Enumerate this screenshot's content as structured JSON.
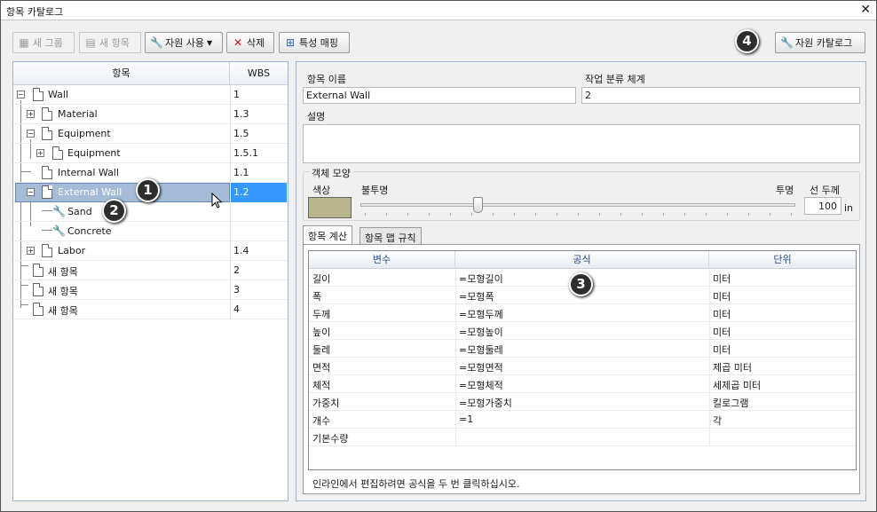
{
  "window": {
    "title": "항목 카탈로그",
    "close_glyph": "✕"
  },
  "toolbar": {
    "new_group": "새 그룹",
    "new_item": "새 항목",
    "use_resource": "자원 사용",
    "delete": "삭제",
    "property_mapping": "특성 매핑",
    "resource_catalog": "자원 카탈로그"
  },
  "tree": {
    "header_item": "항목",
    "header_wbs": "WBS",
    "rows": [
      {
        "label": "Wall",
        "wbs": "1"
      },
      {
        "label": "Material",
        "wbs": "1.3"
      },
      {
        "label": "Equipment",
        "wbs": "1.5"
      },
      {
        "label": "Equipment",
        "wbs": "1.5.1"
      },
      {
        "label": "Internal Wall",
        "wbs": "1.1"
      },
      {
        "label": "External Wall",
        "wbs": "1.2"
      },
      {
        "label": "Sand",
        "wbs": ""
      },
      {
        "label": "Concrete",
        "wbs": ""
      },
      {
        "label": "Labor",
        "wbs": "1.4"
      },
      {
        "label": "새 항목",
        "wbs": "2"
      },
      {
        "label": "새 항목",
        "wbs": "3"
      },
      {
        "label": "새 항목",
        "wbs": "4"
      }
    ]
  },
  "details": {
    "item_name_label": "항목 이름",
    "item_name_value": "External Wall",
    "wbs_label": "작업 분류 체계",
    "wbs_value": "2",
    "description_label": "설명",
    "description_value": "",
    "appearance_label": "객체 모양",
    "color_label": "색상",
    "opaque_label": "불투명",
    "transparent_label": "투명",
    "line_thickness_label": "선 두께",
    "line_thickness_value": "100",
    "line_thickness_unit": "in",
    "transparency_level": 0.27,
    "swatch_color": "#b8b58c"
  },
  "tabs": [
    {
      "label": "항목 계산",
      "active": true
    },
    {
      "label": "항목 맵 규칙",
      "active": false
    }
  ],
  "grid": {
    "headers": [
      "변수",
      "공식",
      "단위"
    ],
    "rows": [
      [
        "길이",
        "=모형길이",
        "미터"
      ],
      [
        "폭",
        "=모형폭",
        "미터"
      ],
      [
        "두께",
        "=모형두께",
        "미터"
      ],
      [
        "높이",
        "=모형높이",
        "미터"
      ],
      [
        "둘레",
        "=모형둘레",
        "미터"
      ],
      [
        "면적",
        "=모형면적",
        "제곱 미터"
      ],
      [
        "체적",
        "=모형체적",
        "세제곱 미터"
      ],
      [
        "가중치",
        "=모형가중치",
        "킬로그램"
      ],
      [
        "개수",
        "=1",
        "각"
      ],
      [
        "기본수량",
        "",
        ""
      ]
    ]
  },
  "status_hint": "인라인에서 편집하려면 공식을 두 번 클릭하십시오.",
  "callouts": [
    "1",
    "2",
    "3",
    "4"
  ],
  "icons": {
    "new_group": "new-group-icon",
    "new_item": "new-item-icon",
    "use_resource": "wrench-icon",
    "delete": "red-x-icon",
    "mapping": "mapping-icon",
    "catalog": "catalog-icon"
  }
}
